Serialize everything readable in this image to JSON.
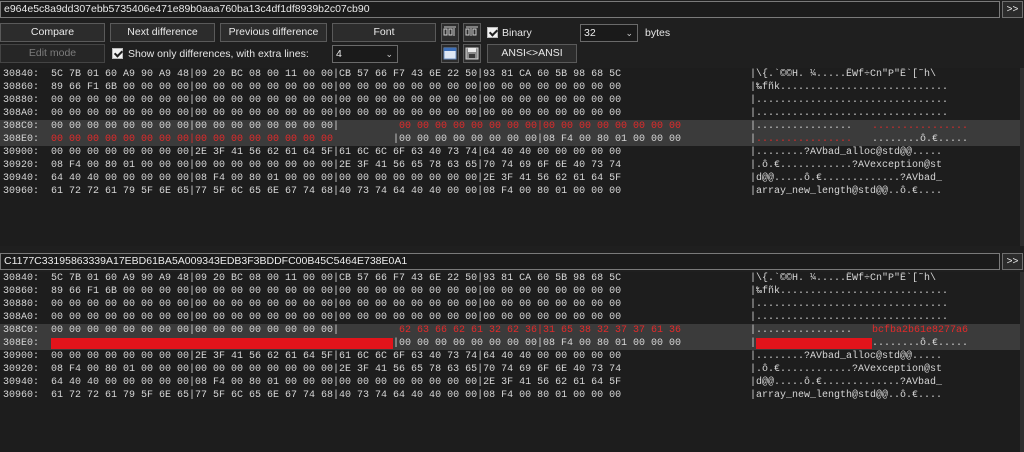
{
  "top_pane": {
    "path": "e964e5c8a9dd307ebb5735406e471e89b0aaa760ba13c4df1df8939b2c07cb90",
    "go": ">>"
  },
  "toolbar": {
    "compare": "Compare",
    "next_difference": "Next difference",
    "previous_difference": "Previous difference",
    "font": "Font",
    "binary_label": "Binary",
    "bytes_value": "32",
    "bytes_label": "bytes",
    "edit_mode": "Edit mode",
    "show_only_diff_label": "Show only differences, with extra lines:",
    "extra_lines_value": "4",
    "ansi_button": "ANSI<>ANSI"
  },
  "bottom_pane": {
    "path": "C1177C33195863339A17EBD61BA5A009343EDB3F3BDDFC00B45C5464E738E0A1",
    "go": ">>"
  },
  "top_rows": [
    {
      "addr": "30840:",
      "h1": "5C 7B 01 60 A9 90 A9 48|09 20 BC 08 00 11 00 00|CB 57 66 F7 43 6E 22 50|93 81 CA 60 5B 98 68 5C",
      "ascii": "|\\{.`©©H. ¼.....ËWf÷Cn\"P\"Ê`[˜h\\"
    },
    {
      "addr": "30860:",
      "h1": "89 66 F1 6B 00 00 00 00|00 00 00 00 00 00 00 00|00 00 00 00 00 00 00 00|00 00 00 00 00 00 00 00",
      "ascii": "|‰fñk............................"
    },
    {
      "addr": "30880:",
      "h1": "00 00 00 00 00 00 00 00|00 00 00 00 00 00 00 00|00 00 00 00 00 00 00 00|00 00 00 00 00 00 00 00",
      "ascii": "|................................"
    },
    {
      "addr": "308A0:",
      "h1": "00 00 00 00 00 00 00 00|00 00 00 00 00 00 00 00|00 00 00 00 00 00 00 00|00 00 00 00 00 00 00 00",
      "ascii": "|................................"
    },
    {
      "addr": "308C0:",
      "hl": true,
      "h1": "00 00 00 00 00 00 00 00|00 00 00 00 00 00 00 00|",
      "h2": "00 00 00 00 00 00 00 00|00 00 00 00 00 00 00 00",
      "ascii1": "|................",
      "ascii2": "................"
    },
    {
      "addr": "308E0:",
      "hl": true,
      "h1r": "00 00 00 00 00 00 00 00|00 00 00 00 00 00 00 00",
      "h2": "|00 00 00 00 00 00 00 00|08 F4 00 80 01 00 00 00",
      "ascii1": "|",
      "ascii2r": "................",
      "ascii3": "........ô.€....."
    },
    {
      "addr": "30900:",
      "h1": "00 00 00 00 00 00 00 00|2E 3F 41 56 62 61 64 5F|61 6C 6C 6F 63 40 73 74|64 40 40 00 00 00 00 00",
      "ascii": "|........?AVbad_alloc@std@@....."
    },
    {
      "addr": "30920:",
      "h1": "08 F4 00 80 01 00 00 00|00 00 00 00 00 00 00 00|2E 3F 41 56 65 78 63 65|70 74 69 6F 6E 40 73 74",
      "ascii": "|.ô.€............?AVexception@st"
    },
    {
      "addr": "30940:",
      "h1": "64 40 40 00 00 00 00 00|08 F4 00 80 01 00 00 00|00 00 00 00 00 00 00 00|2E 3F 41 56 62 61 64 5F",
      "ascii": "|d@@.....ô.€.............?AVbad_"
    },
    {
      "addr": "30960:",
      "h1": "61 72 72 61 79 5F 6E 65|77 5F 6C 65 6E 67 74 68|40 73 74 64 40 40 00 00|08 F4 00 80 01 00 00 00",
      "ascii": "|array_new_length@std@@..ô.€...."
    }
  ],
  "bottom_rows": [
    {
      "addr": "30840:",
      "h1": "5C 7B 01 60 A9 90 A9 48|09 20 BC 08 00 11 00 00|CB 57 66 F7 43 6E 22 50|93 81 CA 60 5B 98 68 5C",
      "ascii": "|\\{.`©©H. ¼.....ËWf÷Cn\"P\"Ê`[˜h\\"
    },
    {
      "addr": "30860:",
      "h1": "89 66 F1 6B 00 00 00 00|00 00 00 00 00 00 00 00|00 00 00 00 00 00 00 00|00 00 00 00 00 00 00 00",
      "ascii": "|‰fñk............................"
    },
    {
      "addr": "30880:",
      "h1": "00 00 00 00 00 00 00 00|00 00 00 00 00 00 00 00|00 00 00 00 00 00 00 00|00 00 00 00 00 00 00 00",
      "ascii": "|................................"
    },
    {
      "addr": "308A0:",
      "h1": "00 00 00 00 00 00 00 00|00 00 00 00 00 00 00 00|00 00 00 00 00 00 00 00|00 00 00 00 00 00 00 00",
      "ascii": "|................................"
    },
    {
      "addr": "308C0:",
      "hl": true,
      "h1": "00 00 00 00 00 00 00 00|00 00 00 00 00 00 00 00|",
      "h2": "62 63 66 62 61 32 62 36|31 65 38 32 37 37 61 36",
      "ascii1": "|................",
      "ascii2": "bcfba2b61e8277a6"
    },
    {
      "addr": "308E0:",
      "hl": true,
      "h2": "|00 00 00 00 00 00 00 00|08 F4 00 80 01 00 00 00",
      "ascii1": "|",
      "ascii3": "........ô.€....."
    },
    {
      "addr": "30900:",
      "h1": "00 00 00 00 00 00 00 00|2E 3F 41 56 62 61 64 5F|61 6C 6C 6F 63 40 73 74|64 40 40 00 00 00 00 00",
      "ascii": "|........?AVbad_alloc@std@@....."
    },
    {
      "addr": "30920:",
      "h1": "08 F4 00 80 01 00 00 00|00 00 00 00 00 00 00 00|2E 3F 41 56 65 78 63 65|70 74 69 6F 6E 40 73 74",
      "ascii": "|.ô.€............?AVexception@st"
    },
    {
      "addr": "30940:",
      "h1": "64 40 40 00 00 00 00 00|08 F4 00 80 01 00 00 00|00 00 00 00 00 00 00 00|2E 3F 41 56 62 61 64 5F",
      "ascii": "|d@@.....ô.€.............?AVbad_"
    },
    {
      "addr": "30960:",
      "h1": "61 72 72 61 79 5F 6E 65|77 5F 6C 65 6E 67 74 68|40 73 74 64 40 40 00 00|08 F4 00 80 01 00 00 00",
      "ascii": "|array_new_length@std@@..ô.€...."
    }
  ],
  "colors": {
    "diff_text": "#e22a2a",
    "diff_fill": "#e2141b",
    "highlight_row": "#3b3b3b",
    "background": "#1d1d1d"
  }
}
